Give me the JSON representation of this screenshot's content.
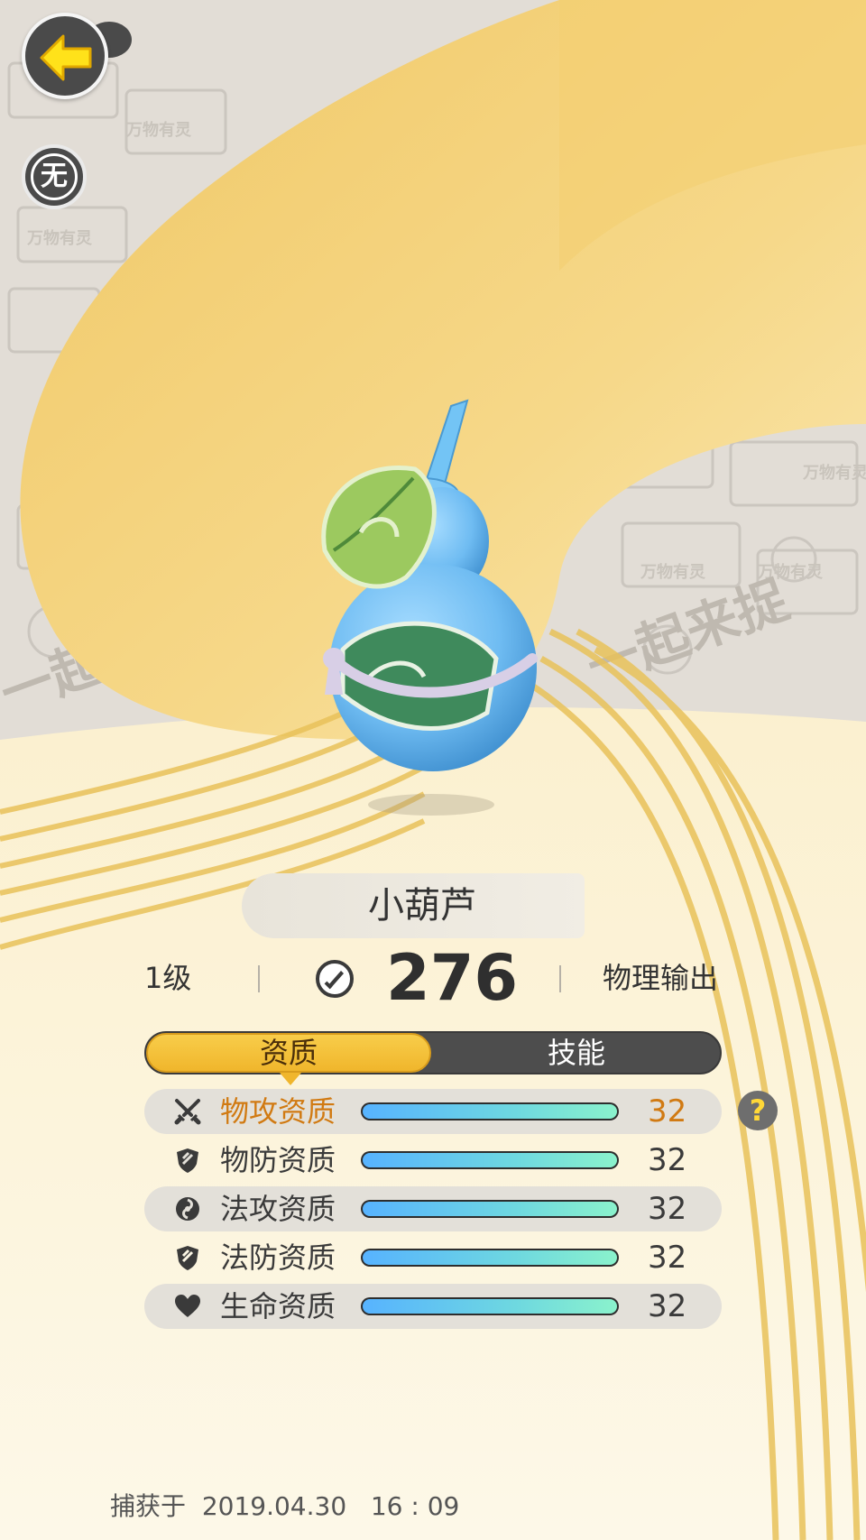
{
  "header": {
    "back_label": "back",
    "none_badge": "无"
  },
  "monster": {
    "name": "小葫芦",
    "level": "1级",
    "power": "276",
    "role": "物理输出"
  },
  "tabs": {
    "active": "资质",
    "other": "技能"
  },
  "aptitudes": [
    {
      "label": "物攻资质",
      "value": "32",
      "fraction": 1.0,
      "icon": "crossed-swords-icon",
      "highlight": true
    },
    {
      "label": "物防资质",
      "value": "32",
      "fraction": 1.0,
      "icon": "shield-icon",
      "highlight": false
    },
    {
      "label": "法攻资质",
      "value": "32",
      "fraction": 1.0,
      "icon": "magic-swirl-icon",
      "highlight": false
    },
    {
      "label": "法防资质",
      "value": "32",
      "fraction": 1.0,
      "icon": "shield-icon",
      "highlight": false
    },
    {
      "label": "生命资质",
      "value": "32",
      "fraction": 1.0,
      "icon": "heart-icon",
      "highlight": false
    }
  ],
  "help": "?",
  "capture": {
    "label": "捕获于",
    "date": "2019.04.30",
    "time": "16 : 09"
  },
  "colors": {
    "accent_gold": "#f0b62c",
    "highlight_text": "#d17a12",
    "bar_start": "#57b3ff",
    "bar_end": "#8af2cc"
  }
}
